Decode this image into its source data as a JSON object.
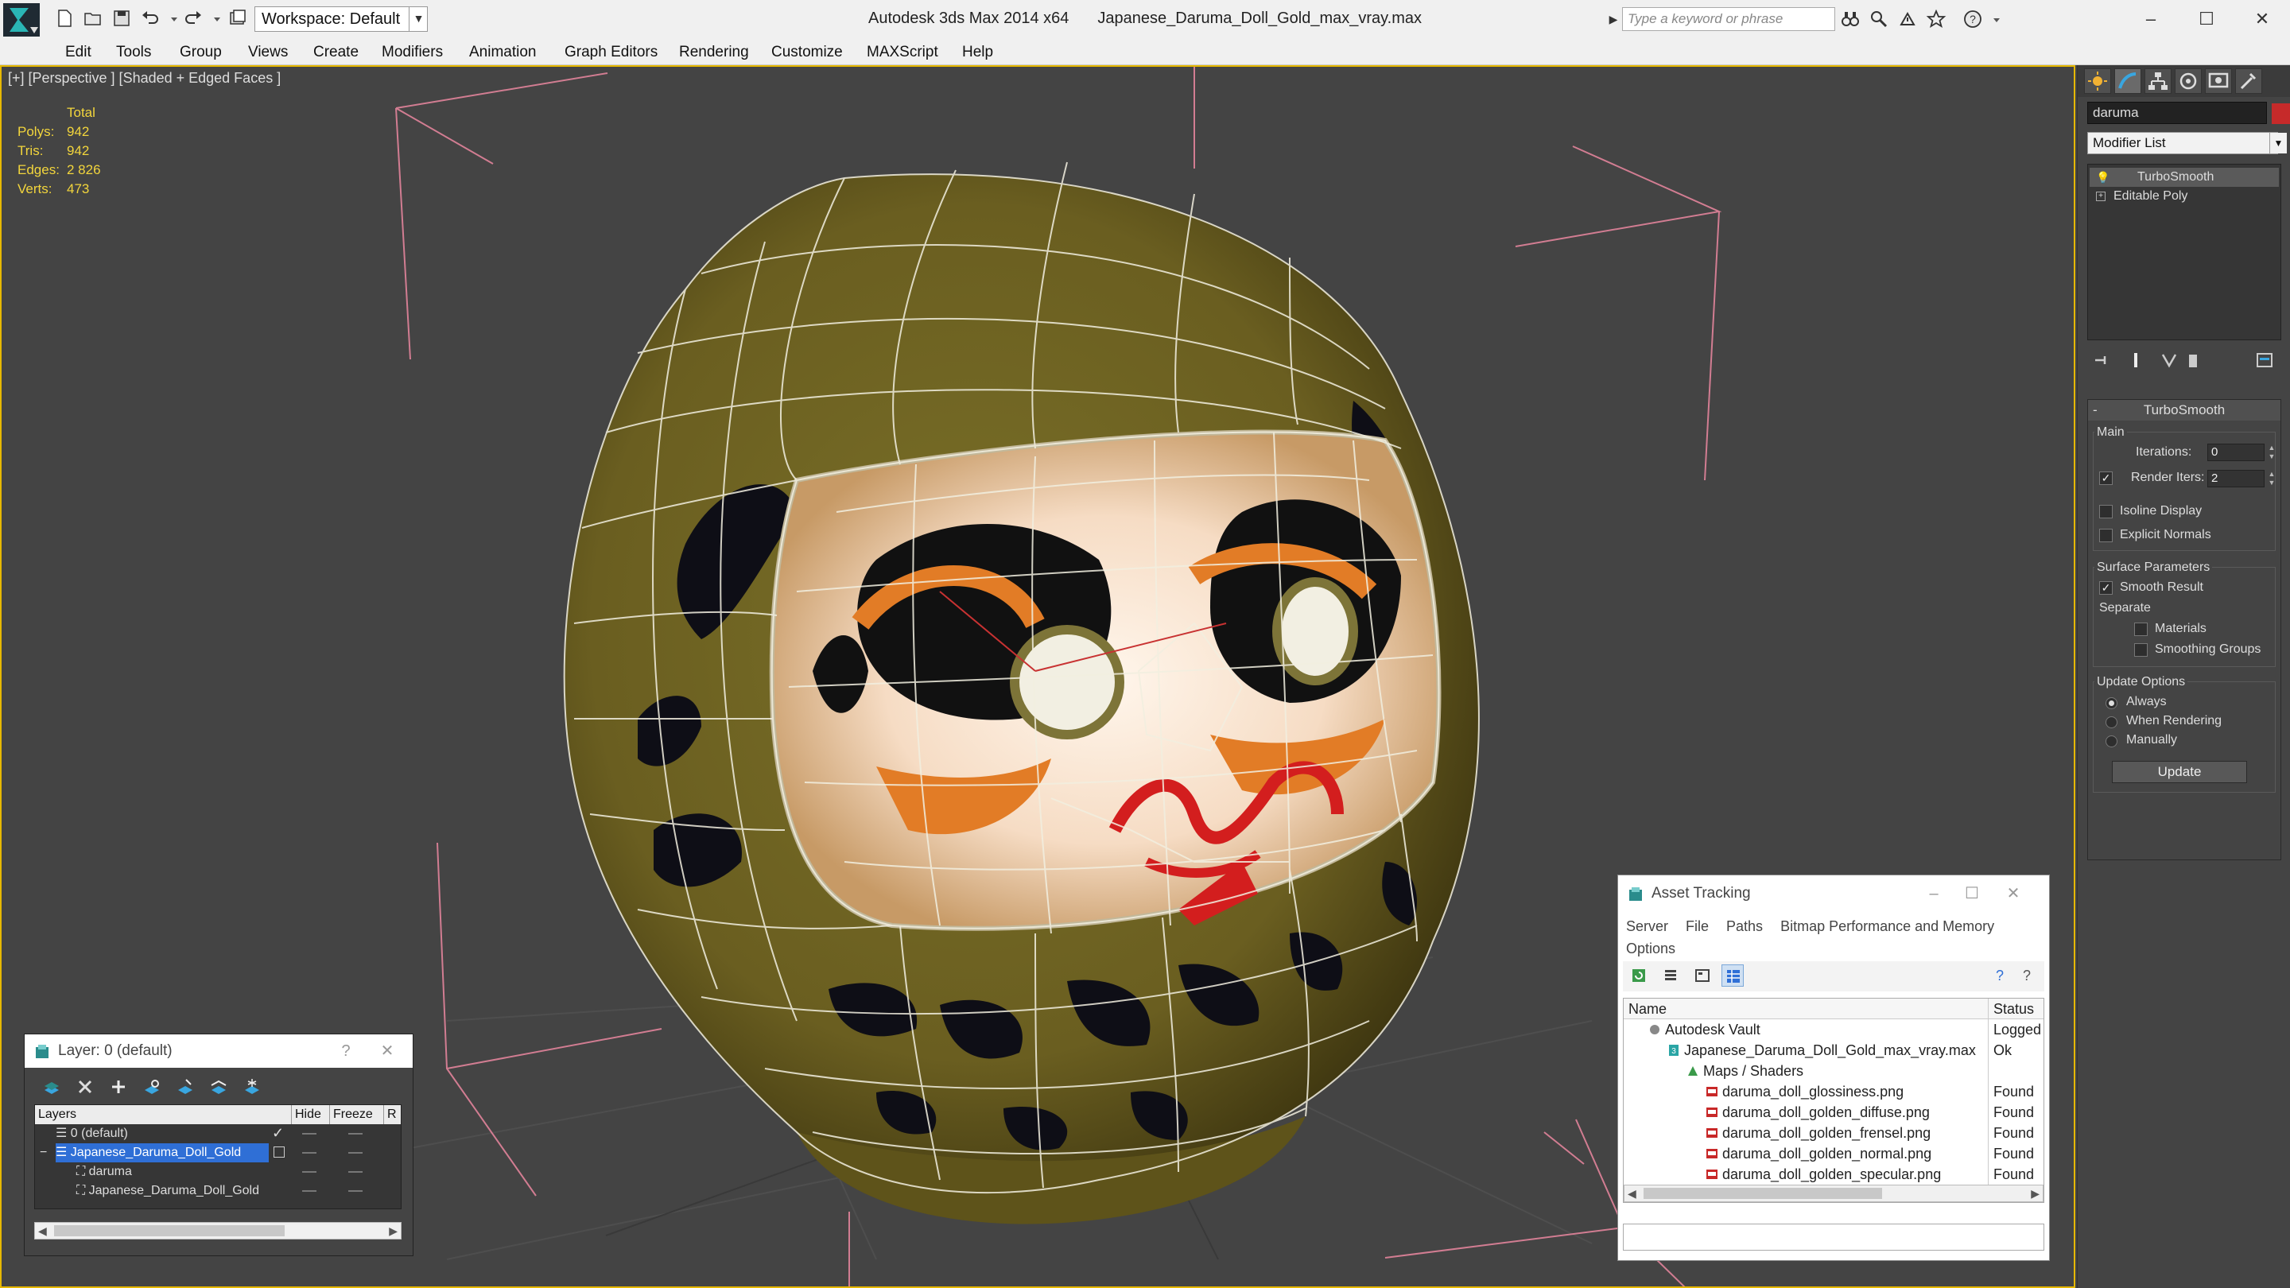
{
  "titlebar": {
    "app_title": "Autodesk 3ds Max  2014 x64",
    "file_title": "Japanese_Daruma_Doll_Gold_max_vray.max",
    "workspace": "Workspace: Default",
    "search_placeholder": "Type a keyword or phrase"
  },
  "menu": [
    "Edit",
    "Tools",
    "Group",
    "Views",
    "Create",
    "Modifiers",
    "Animation",
    "Graph Editors",
    "Rendering",
    "Customize",
    "MAXScript",
    "Help"
  ],
  "viewport": {
    "label": "[+] [Perspective ] [Shaded + Edged Faces ]",
    "stats": {
      "header": "Total",
      "rows": [
        {
          "key": "Polys:",
          "value": "942"
        },
        {
          "key": "Tris:",
          "value": "942"
        },
        {
          "key": "Edges:",
          "value": "2 826"
        },
        {
          "key": "Verts:",
          "value": "473"
        }
      ]
    }
  },
  "command_panel": {
    "object_name": "daruma",
    "object_color": "#c62a2a",
    "modifier_list": "Modifier List",
    "stack": [
      "TurboSmooth",
      "Editable Poly"
    ],
    "rollout": {
      "title": "TurboSmooth",
      "main_label": "Main",
      "iterations_label": "Iterations:",
      "iterations_value": "0",
      "render_iters_label": "Render Iters:",
      "render_iters_value": "2",
      "render_iters_checked": true,
      "isoline_label": "Isoline Display",
      "explicit_normals_label": "Explicit Normals",
      "surface_label": "Surface Parameters",
      "smooth_result_label": "Smooth Result",
      "separate_label": "Separate",
      "materials_label": "Materials",
      "smoothing_groups_label": "Smoothing Groups",
      "update_options_label": "Update Options",
      "always_label": "Always",
      "when_rendering_label": "When Rendering",
      "manually_label": "Manually",
      "update_button": "Update"
    }
  },
  "asset_tracking": {
    "title": "Asset Tracking",
    "menu": [
      "Server",
      "File",
      "Paths",
      "Bitmap Performance and Memory",
      "Options"
    ],
    "columns": [
      "Name",
      "Status"
    ],
    "rows": [
      {
        "name": "Autodesk Vault",
        "status": "Logged",
        "indent": 0,
        "icon": "vault-icon"
      },
      {
        "name": "Japanese_Daruma_Doll_Gold_max_vray.max",
        "status": "Ok",
        "indent": 1,
        "icon": "max-file-icon"
      },
      {
        "name": "Maps / Shaders",
        "status": "",
        "indent": 2,
        "icon": "maps-icon"
      },
      {
        "name": "daruma_doll_glossiness.png",
        "status": "Found",
        "indent": 3,
        "icon": "png-icon"
      },
      {
        "name": "daruma_doll_golden_diffuse.png",
        "status": "Found",
        "indent": 3,
        "icon": "png-icon"
      },
      {
        "name": "daruma_doll_golden_frensel.png",
        "status": "Found",
        "indent": 3,
        "icon": "png-icon"
      },
      {
        "name": "daruma_doll_golden_normal.png",
        "status": "Found",
        "indent": 3,
        "icon": "png-icon"
      },
      {
        "name": "daruma_doll_golden_specular.png",
        "status": "Found",
        "indent": 3,
        "icon": "png-icon"
      }
    ]
  },
  "layer_dialog": {
    "title": "Layer: 0 (default)",
    "help": "?",
    "columns": [
      "Layers",
      "Hide",
      "Freeze",
      "R"
    ],
    "rows": [
      {
        "name": "0 (default)",
        "indent": 1,
        "selected": false,
        "current": true
      },
      {
        "name": "Japanese_Daruma_Doll_Gold",
        "indent": 1,
        "selected": true,
        "current": false
      },
      {
        "name": "daruma",
        "indent": 2,
        "selected": false,
        "current": false
      },
      {
        "name": "Japanese_Daruma_Doll_Gold",
        "indent": 2,
        "selected": false,
        "current": false
      }
    ]
  }
}
